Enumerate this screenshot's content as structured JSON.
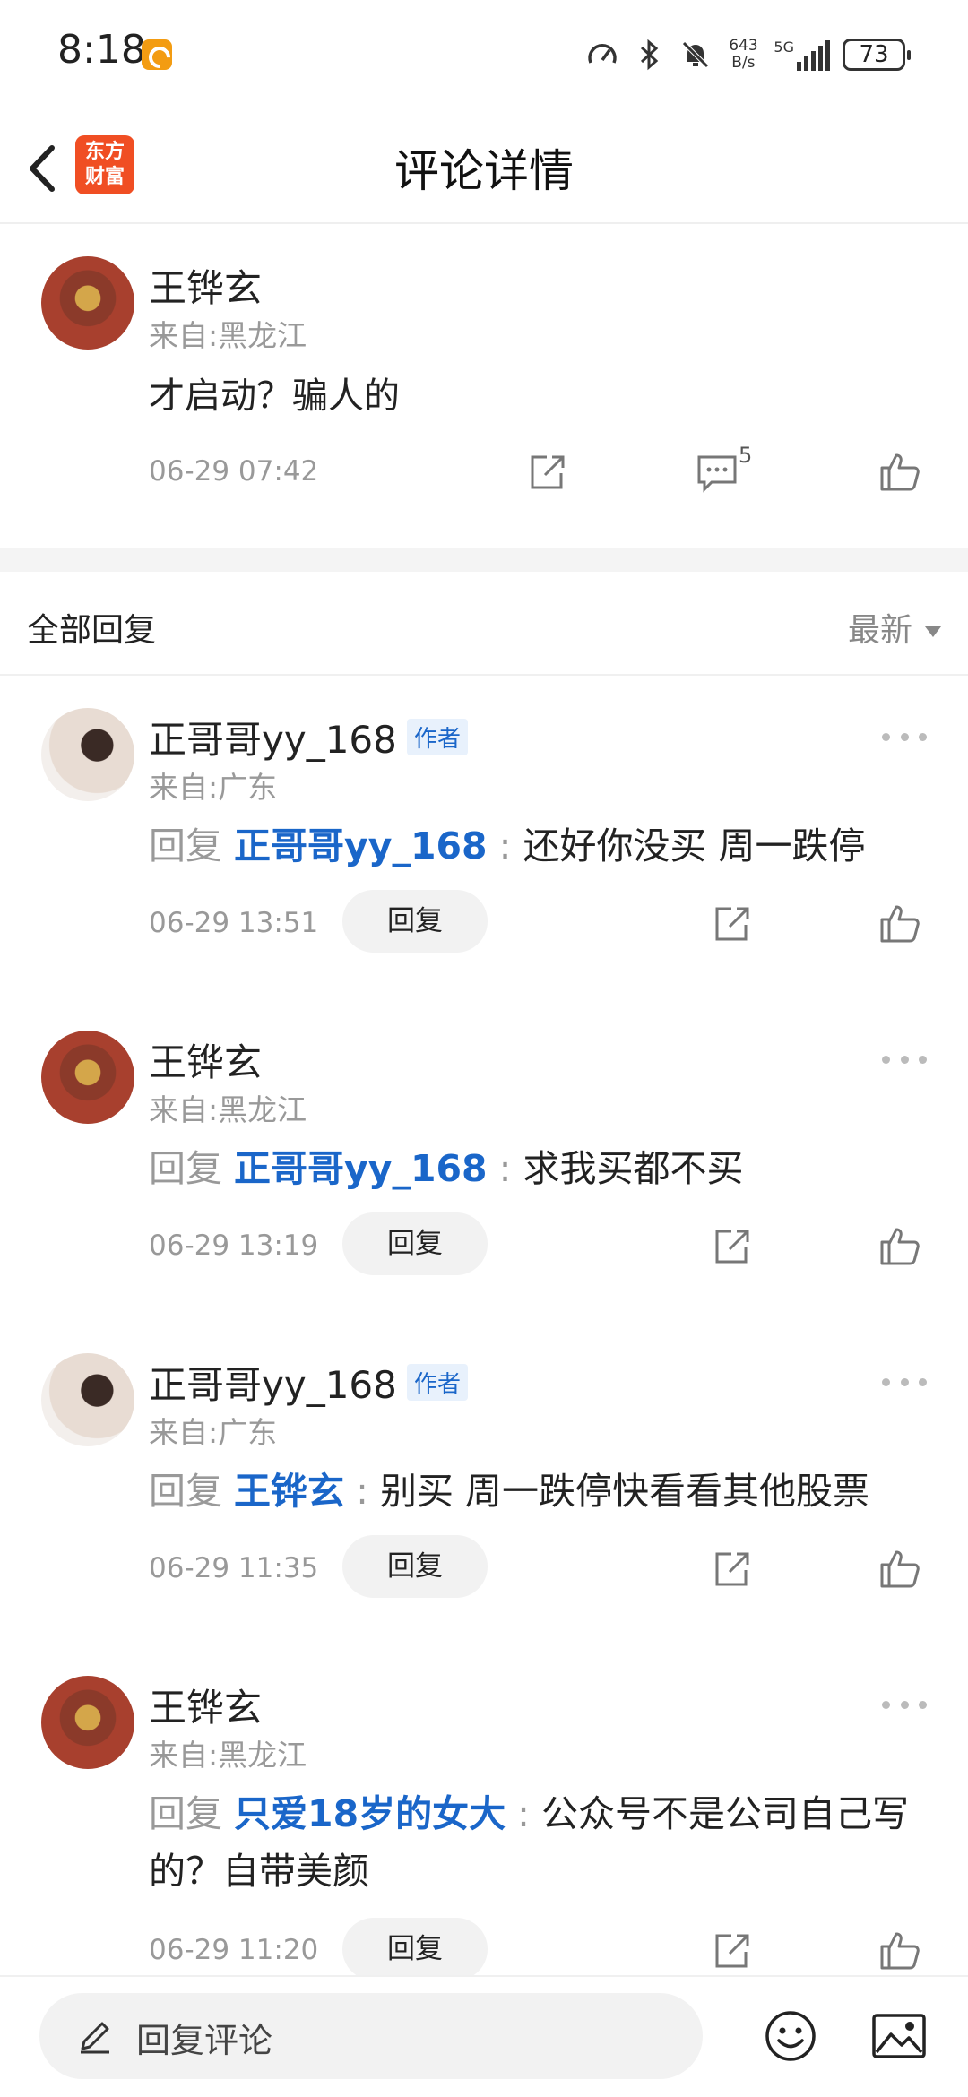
{
  "status_bar": {
    "time": "8:18",
    "net_speed_value": "643",
    "net_speed_unit": "B/s",
    "signal_label": "5G",
    "battery": "73"
  },
  "header": {
    "logo_line1": "东方",
    "logo_line2": "财富",
    "title": "评论详情"
  },
  "main_comment": {
    "author": "王铧玄",
    "location": "来自:黑龙江",
    "text": "才启动？骗人的",
    "time": "06-29 07:42",
    "reply_count": "5"
  },
  "replies_section": {
    "title": "全部回复",
    "sort_label": "最新"
  },
  "replies": [
    {
      "author": "正哥哥yy_168",
      "tag": "作者",
      "location": "来自:广东",
      "prefix": "回复",
      "target": "正哥哥yy_168",
      "separator": ":",
      "text": "还好你没买 周一跌停",
      "time": "06-29 13:51",
      "reply_label": "回复"
    },
    {
      "author": "王铧玄",
      "tag": "",
      "location": "来自:黑龙江",
      "prefix": "回复",
      "target": "正哥哥yy_168",
      "separator": ":",
      "text": "求我买都不买",
      "time": "06-29 13:19",
      "reply_label": "回复"
    },
    {
      "author": "正哥哥yy_168",
      "tag": "作者",
      "location": "来自:广东",
      "prefix": "回复",
      "target": "王铧玄",
      "separator": ":",
      "text": "别买 周一跌停快看看其他股票",
      "time": "06-29 11:35",
      "reply_label": "回复"
    },
    {
      "author": "王铧玄",
      "tag": "",
      "location": "来自:黑龙江",
      "prefix": "回复",
      "target": "只爱18岁的女大",
      "separator": ":",
      "text": "公众号不是公司自己写的？自带美颜",
      "time": "06-29 11:20",
      "reply_label": "回复"
    }
  ],
  "bottom_bar": {
    "placeholder": "回复评论"
  },
  "colors": {
    "link_blue": "#1a66c9",
    "logo_red": "#f04e23",
    "muted_gray": "#999999"
  },
  "icons": [
    "back-arrow-icon",
    "share-icon",
    "comment-icon",
    "thumbs-up-icon",
    "more-dots-icon",
    "pencil-icon",
    "emoji-icon",
    "image-icon"
  ]
}
